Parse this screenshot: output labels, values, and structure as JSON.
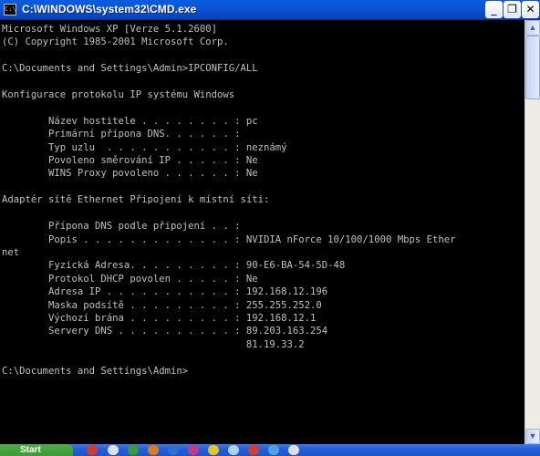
{
  "window": {
    "title": "C:\\WINDOWS\\system32\\CMD.exe",
    "icon": "cmd-icon"
  },
  "console_lines": [
    "Microsoft Windows XP [Verze 5.1.2600]",
    "(C) Copyright 1985-2001 Microsoft Corp.",
    "",
    "C:\\Documents and Settings\\Admin>IPCONFIG/ALL",
    "",
    "Konfigurace protokolu IP systému Windows",
    "",
    "        Název hostitele . . . . . . . . : pc",
    "        Primární přípona DNS. . . . . . :",
    "        Typ uzlu  . . . . . . . . . . . : neznámý",
    "        Povoleno směrování IP . . . . . : Ne",
    "        WINS Proxy povoleno . . . . . . : Ne",
    "",
    "Adaptér sítě Ethernet Připojení k místní síti:",
    "",
    "        Přípona DNS podle připojení . . :",
    "        Popis . . . . . . . . . . . . . : NVIDIA nForce 10/100/1000 Mbps Ether",
    "net",
    "        Fyzická Adresa. . . . . . . . . : 90-E6-BA-54-5D-48",
    "        Protokol DHCP povolen . . . . . : Ne",
    "        Adresa IP . . . . . . . . . . . : 192.168.12.196",
    "        Maska podsítě . . . . . . . . . : 255.255.252.0",
    "        Výchozí brána . . . . . . . . . : 192.168.12.1",
    "        Servery DNS . . . . . . . . . . : 89.203.163.254",
    "                                          81.19.33.2",
    "",
    "C:\\Documents and Settings\\Admin>"
  ],
  "taskbar": {
    "start_label": "Start"
  }
}
